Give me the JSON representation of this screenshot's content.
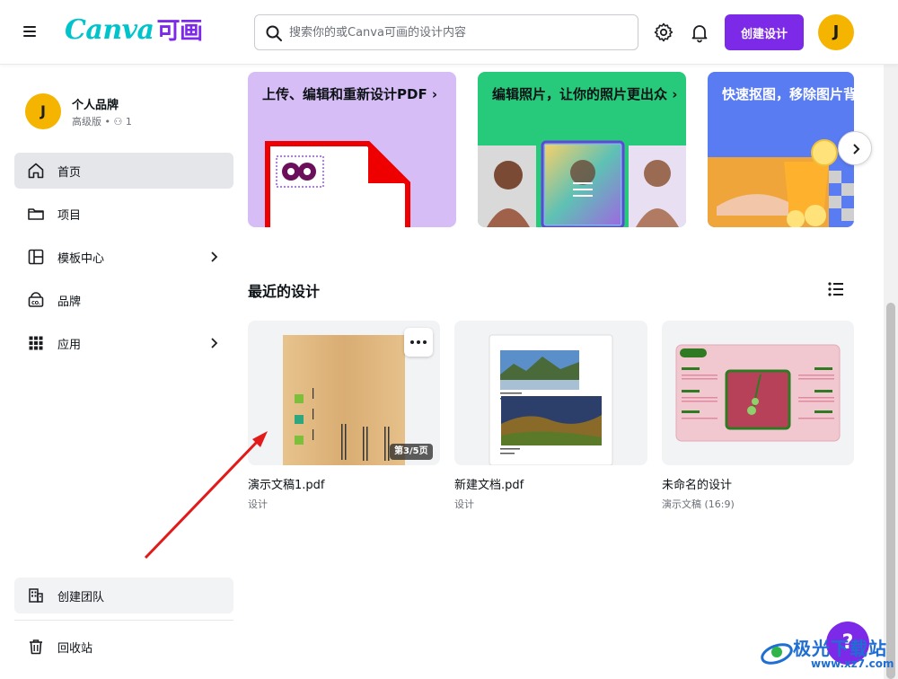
{
  "header": {
    "logo_text": "Canva",
    "logo_zh": "可画",
    "search_placeholder": "搜索你的或Canva可画的设计内容",
    "create_label": "创建设计",
    "avatar_initial": "J"
  },
  "sidebar": {
    "avatar_initial": "J",
    "brand_name": "个人品牌",
    "brand_sub": "高级版 • ⚇ 1",
    "items": [
      {
        "label": "首页",
        "icon": "home-icon",
        "active": true
      },
      {
        "label": "项目",
        "icon": "folder-icon"
      },
      {
        "label": "模板中心",
        "icon": "template-icon"
      },
      {
        "label": "品牌",
        "icon": "brand-icon"
      },
      {
        "label": "应用",
        "icon": "apps-grid-icon"
      }
    ],
    "team_label": "创建团队",
    "trash_label": "回收站"
  },
  "features": [
    {
      "title": "上传、编辑和重新设计PDF ›"
    },
    {
      "title": "编辑照片，让你的照片更出众 ›"
    },
    {
      "title": "快速抠图，移除图片背景"
    }
  ],
  "recent": {
    "title": "最近的设计",
    "designs": [
      {
        "name": "演示文稿1.pdf",
        "type": "设计",
        "badge": "第3/5页"
      },
      {
        "name": "新建文档.pdf",
        "type": "设计"
      },
      {
        "name": "未命名的设计",
        "type": "演示文稿 (16:9)"
      }
    ]
  },
  "help_label": "?",
  "watermark": {
    "text": "极光下载站",
    "url": "www.xz7.com"
  },
  "colors": {
    "brand_purple": "#7d2ae8",
    "brand_teal": "#00c4cc",
    "avatar_yellow": "#f5b400"
  }
}
